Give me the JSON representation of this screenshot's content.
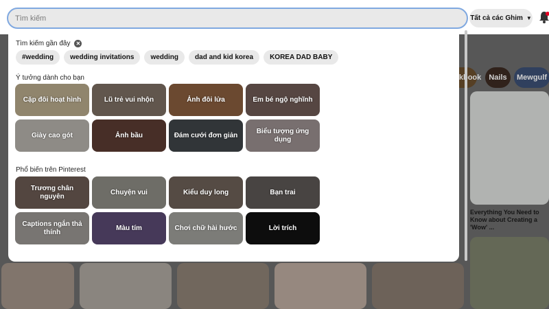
{
  "search": {
    "placeholder": "Tìm kiếm",
    "scope_label": "Tất cả các Ghim"
  },
  "background": {
    "chips": [
      "Lookbook",
      "Nails",
      "Mewgulf"
    ],
    "pin_caption": "Everything You Need to Know about Creating a 'Wow' ..."
  },
  "recent": {
    "title": "Tìm kiếm gần đây",
    "items": [
      "#wedding",
      "wedding invitations",
      "wedding",
      "dad and kid korea",
      "KOREA DAD BABY"
    ]
  },
  "ideas": {
    "title": "Ý tưởng dành cho bạn",
    "tiles": [
      {
        "label": "Cặp đôi hoạt hình",
        "color": "#b9ab8c"
      },
      {
        "label": "Lũ trẻ vui nhộn",
        "color": "#7d6f63"
      },
      {
        "label": "Ảnh đôi lửa",
        "color": "#8a5e3e"
      },
      {
        "label": "Em bé ngộ nghĩnh",
        "color": "#6f5a55"
      },
      {
        "label": "Giày cao gót",
        "color": "#b7b3ac"
      },
      {
        "label": "Ảnh bầu",
        "color": "#5b3b32"
      },
      {
        "label": "Đám cưới đơn giản",
        "color": "#3f4548"
      },
      {
        "label": "Biểu tượng ứng dụng",
        "color": "#9a8f8f"
      }
    ]
  },
  "popular": {
    "title": "Phổ biến trên Pinterest",
    "tiles": [
      {
        "label": "Trương chân nguyên",
        "color": "#6b5a52"
      },
      {
        "label": "Chuyện vui",
        "color": "#8d8c84"
      },
      {
        "label": "Kiểu duy long",
        "color": "#6e6058"
      },
      {
        "label": "Bạn trai",
        "color": "#5d5855"
      },
      {
        "label": "Captions ngắn thả thính",
        "color": "#9a9693"
      },
      {
        "label": "Màu tím",
        "color": "#5a4a72"
      },
      {
        "label": "Chơi chữ hài hước",
        "color": "#9f9f9a"
      },
      {
        "label": "Lời trích",
        "color": "#111111"
      }
    ]
  }
}
